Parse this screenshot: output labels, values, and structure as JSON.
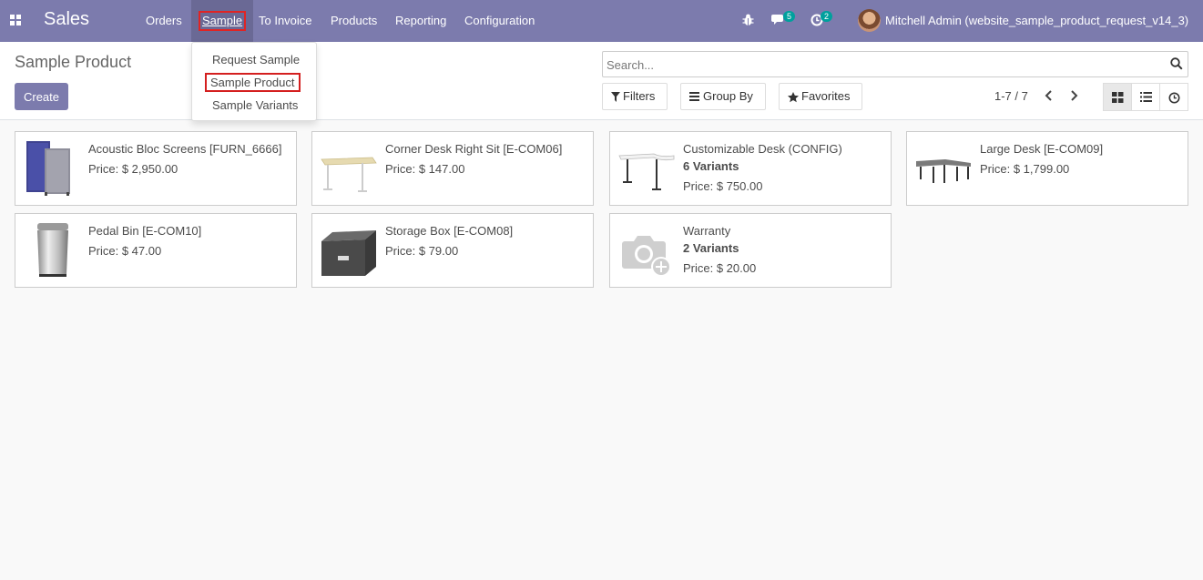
{
  "navbar": {
    "brand": "Sales",
    "menus": [
      "Orders",
      "Sample",
      "To Invoice",
      "Products",
      "Reporting",
      "Configuration"
    ],
    "active_menu": "Sample",
    "messages_count": "5",
    "activities_count": "2",
    "user_name": "Mitchell Admin (website_sample_product_request_v14_3)",
    "accent_color": "#7c7bad"
  },
  "dropdown": {
    "items": [
      "Request Sample",
      "Sample Product",
      "Sample Variants"
    ],
    "highlighted": "Sample Product"
  },
  "control_panel": {
    "title": "Sample Product",
    "create_label": "Create",
    "search_placeholder": "Search...",
    "filters_label": "Filters",
    "groupby_label": "Group By",
    "favorites_label": "Favorites",
    "pager": "1-7 / 7",
    "views": [
      "kanban-icon",
      "list-icon",
      "clock-icon"
    ],
    "active_view": "kanban"
  },
  "products": [
    {
      "name": "Acoustic Bloc Screens [FURN_6666]",
      "variants": "",
      "price": "Price: $ 2,950.00",
      "image": "acoustic-screens"
    },
    {
      "name": "Corner Desk Right Sit [E-COM06]",
      "variants": "",
      "price": "Price: $ 147.00",
      "image": "corner-desk"
    },
    {
      "name": "Customizable Desk (CONFIG)",
      "variants": "6 Variants",
      "price": "Price: $ 750.00",
      "image": "customizable-desk"
    },
    {
      "name": "Large Desk [E-COM09]",
      "variants": "",
      "price": "Price: $ 1,799.00",
      "image": "large-desk"
    },
    {
      "name": "Pedal Bin [E-COM10]",
      "variants": "",
      "price": "Price: $ 47.00",
      "image": "pedal-bin"
    },
    {
      "name": "Storage Box [E-COM08]",
      "variants": "",
      "price": "Price: $ 79.00",
      "image": "storage-box"
    },
    {
      "name": "Warranty",
      "variants": "2 Variants",
      "price": "Price: $ 20.00",
      "image": "camera-placeholder"
    }
  ]
}
